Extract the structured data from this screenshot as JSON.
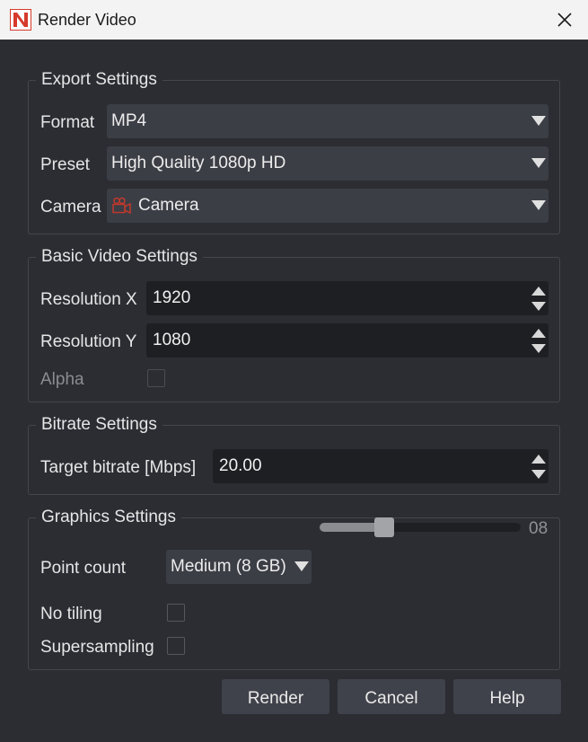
{
  "window": {
    "title": "Render Video",
    "app_icon": "render-app-icon",
    "accent": "#d63a2a"
  },
  "export": {
    "title": "Export Settings",
    "format_label": "Format",
    "format_value": "MP4",
    "preset_label": "Preset",
    "preset_value": "High Quality 1080p HD",
    "camera_label": "Camera",
    "camera_value": "Camera",
    "camera_icon": "camera-icon"
  },
  "video": {
    "title": "Basic Video Settings",
    "resx_label": "Resolution X",
    "resx_value": "1920",
    "resy_label": "Resolution Y",
    "resy_value": "1080",
    "alpha_label": "Alpha",
    "alpha_checked": false
  },
  "bitrate": {
    "title": "Bitrate Settings",
    "target_label": "Target bitrate [Mbps]",
    "target_value": "20.00"
  },
  "graphics": {
    "title": "Graphics Settings",
    "point_count_label": "Point count",
    "point_count_value": "Medium (8 GB)",
    "slider_value": "08",
    "slider_fraction": 0.32,
    "no_tiling_label": "No tiling",
    "no_tiling_checked": false,
    "supersampling_label": "Supersampling",
    "supersampling_checked": false
  },
  "buttons": {
    "render": "Render",
    "cancel": "Cancel",
    "help": "Help"
  }
}
